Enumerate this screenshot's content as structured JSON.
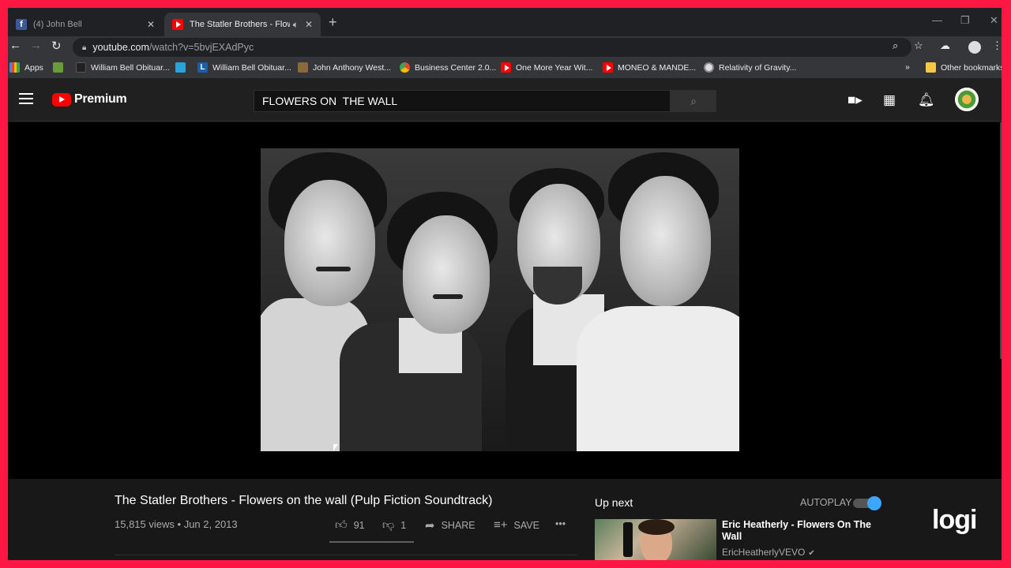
{
  "browser": {
    "tabs": [
      {
        "title": "(4) John Bell",
        "icon": "facebook-icon"
      },
      {
        "title": "The Statler Brothers - Flowers on the wall (Pulp Fiction Soundtrack) - YouTube",
        "icon": "youtube-icon"
      }
    ],
    "url_host": "youtube.com",
    "url_path": "/watch?v=5bvjEXAdPyc",
    "bookmarks": [
      {
        "label": "Apps"
      },
      {
        "label": ""
      },
      {
        "label": "William Bell Obituar..."
      },
      {
        "label": ""
      },
      {
        "label": "William Bell Obituar..."
      },
      {
        "label": "John Anthony West..."
      },
      {
        "label": "Business Center 2.0..."
      },
      {
        "label": "One More Year Wit..."
      },
      {
        "label": "MONEO & MANDE..."
      },
      {
        "label": "Relativity of Gravity..."
      },
      {
        "label": "»"
      },
      {
        "label": "Other bookmarks"
      }
    ]
  },
  "youtube": {
    "logo_text": "Premium",
    "search_value": "FLOWERS ON  THE WALL",
    "colors": {
      "accent": "#ff0000",
      "autoplay": "#3ea6ff",
      "frame": "#ff1744"
    }
  },
  "video": {
    "title": "The Statler Brothers - Flowers on the wall (Pulp Fiction Soundtrack)",
    "views": "15,815 views",
    "date": "Jun 2, 2013",
    "likes": "91",
    "dislikes": "1",
    "share_label": "SHARE",
    "save_label": "SAVE",
    "more_label": "•••"
  },
  "sidebar": {
    "up_next_label": "Up next",
    "autoplay_label": "AUTOPLAY",
    "autoplay_on": true,
    "next_video": {
      "title": "Eric Heatherly - Flowers On The Wall",
      "channel": "EricHeatherlyVEVO"
    }
  },
  "watermark": "logi"
}
